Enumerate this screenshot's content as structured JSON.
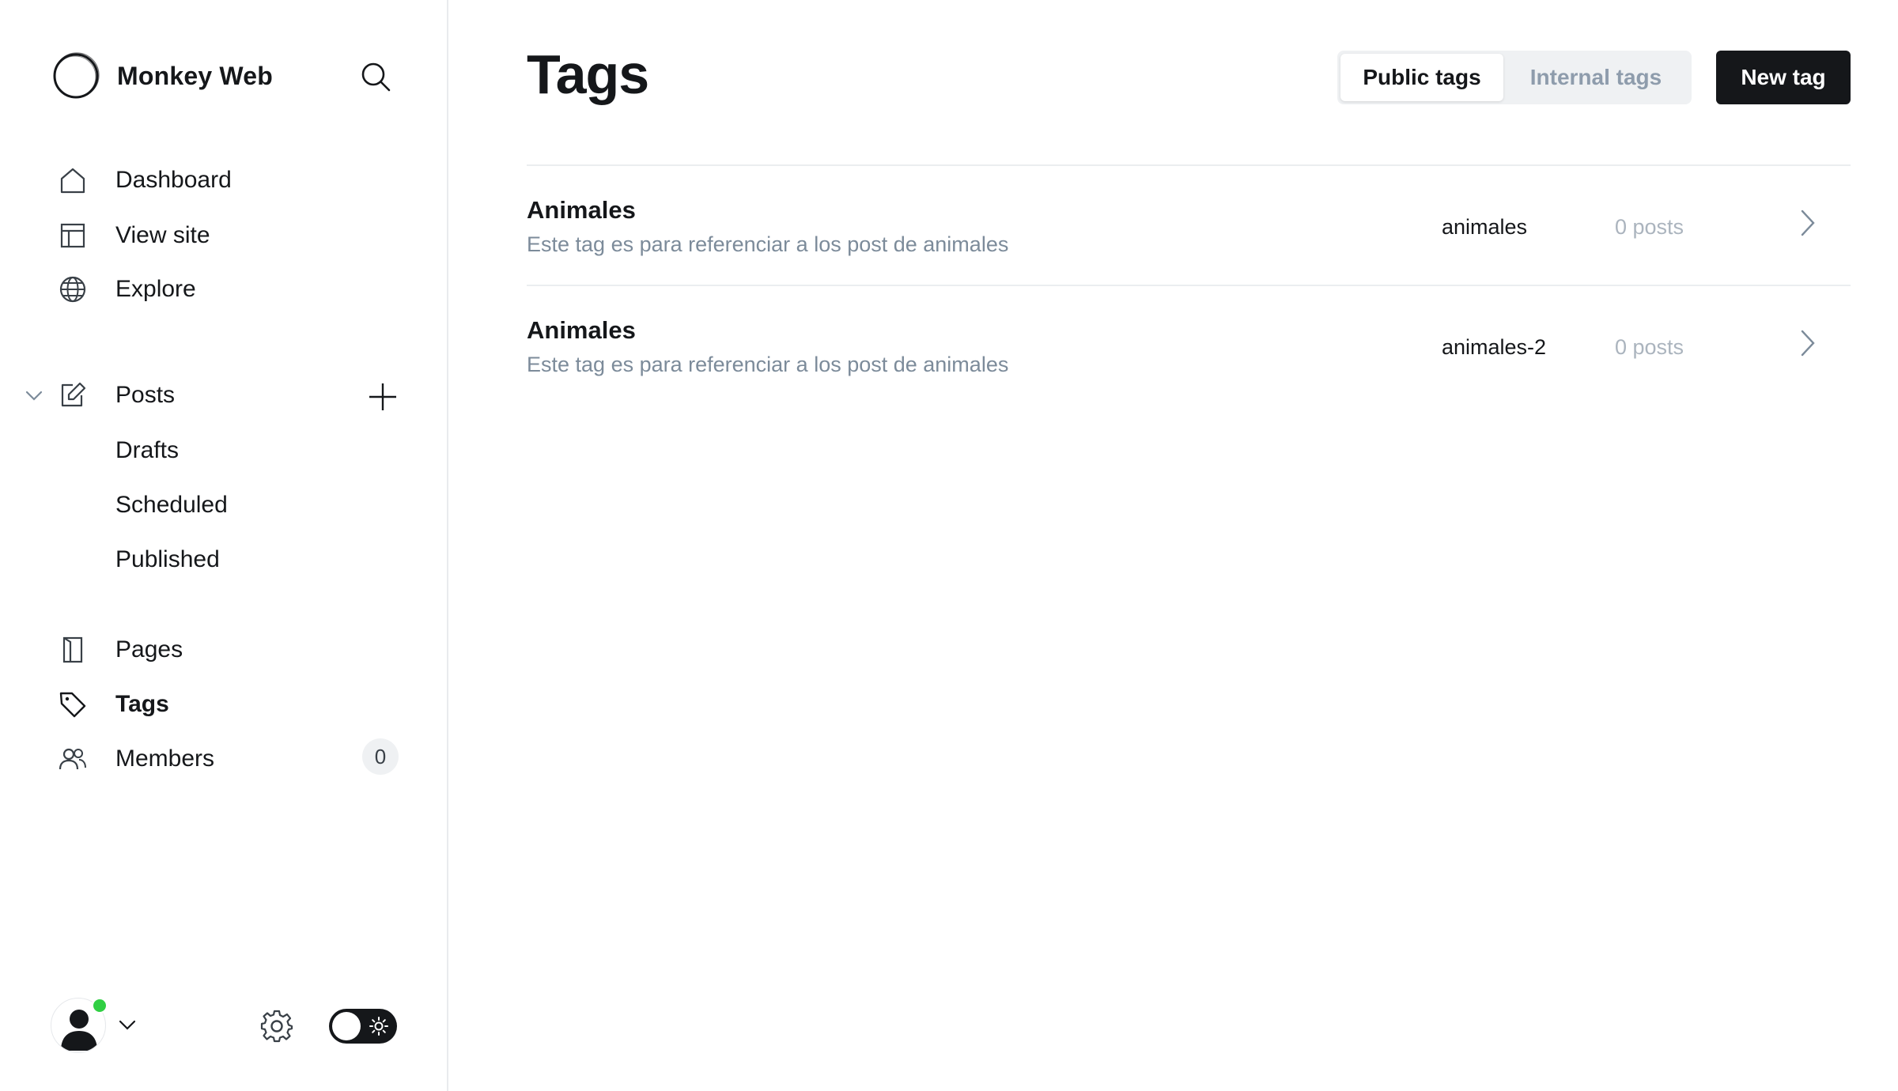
{
  "app": {
    "site_name": "Monkey Web"
  },
  "sidebar": {
    "nav_top": [
      {
        "label": "Dashboard",
        "icon": "house-icon"
      },
      {
        "label": "View site",
        "icon": "layout-icon"
      },
      {
        "label": "Explore",
        "icon": "globe-icon"
      }
    ],
    "posts": {
      "label": "Posts",
      "icon": "edit-icon",
      "expanded": true,
      "sub_items": [
        "Drafts",
        "Scheduled",
        "Published"
      ]
    },
    "nav_bottom": [
      {
        "label": "Pages",
        "icon": "page-icon"
      },
      {
        "label": "Tags",
        "icon": "tag-icon",
        "active": true
      },
      {
        "label": "Members",
        "icon": "members-icon",
        "badge": "0"
      }
    ],
    "footer": {
      "user_online": true,
      "theme": "light"
    }
  },
  "main": {
    "title": "Tags",
    "tabs": [
      {
        "label": "Public tags",
        "active": true
      },
      {
        "label": "Internal tags",
        "active": false
      }
    ],
    "new_tag_label": "New tag",
    "tags": [
      {
        "name": "Animales",
        "description": "Este tag es para referenciar a los post de animales",
        "slug": "animales",
        "count": "0 posts"
      },
      {
        "name": "Animales",
        "description": "Este tag es para referenciar a los post de animales",
        "slug": "animales-2",
        "count": "0 posts"
      }
    ]
  },
  "colors": {
    "primary_button": "#15171a",
    "muted_text": "#7c8b9a",
    "online_dot": "#30cf43",
    "divider": "#ebeef0"
  }
}
